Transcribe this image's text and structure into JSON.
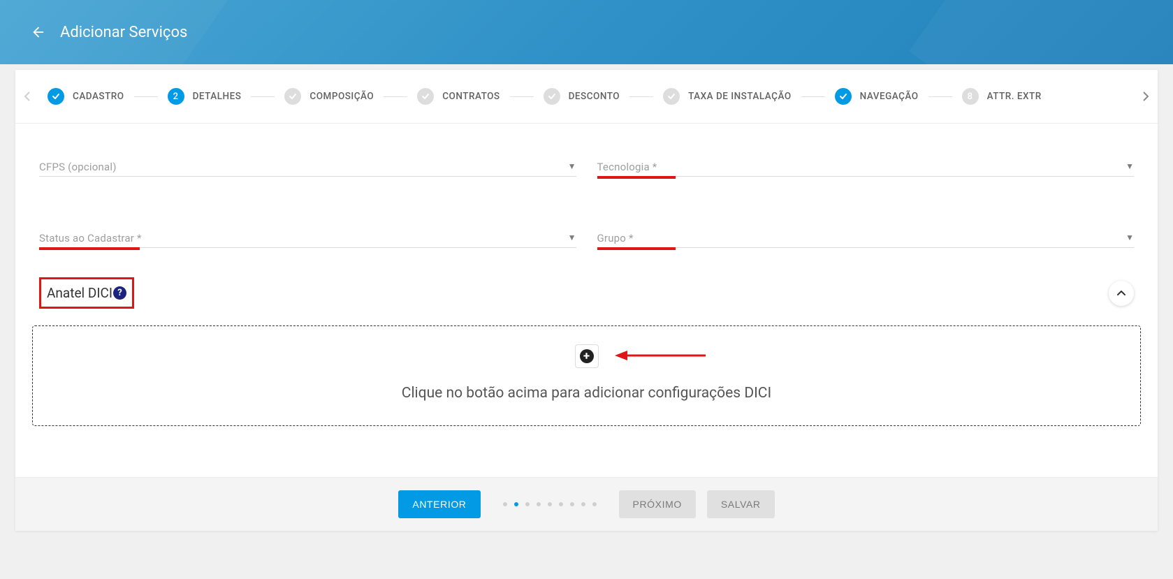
{
  "header": {
    "title": "Adicionar Serviços"
  },
  "stepper": {
    "steps": [
      {
        "label": "CADASTRO",
        "state": "done"
      },
      {
        "label": "DETALHES",
        "state": "current",
        "number": "2"
      },
      {
        "label": "COMPOSIÇÃO",
        "state": "pending"
      },
      {
        "label": "CONTRATOS",
        "state": "pending"
      },
      {
        "label": "DESCONTO",
        "state": "pending"
      },
      {
        "label": "TAXA DE INSTALAÇÃO",
        "state": "pending"
      },
      {
        "label": "NAVEGAÇÃO",
        "state": "done"
      },
      {
        "label": "ATTR. EXTR",
        "state": "pending",
        "number": "8"
      }
    ]
  },
  "form": {
    "cfps": {
      "label": "CFPS (opcional)"
    },
    "tech": {
      "label": "Tecnologia *"
    },
    "status": {
      "label": "Status ao Cadastrar *"
    },
    "group": {
      "label": "Grupo *"
    }
  },
  "section": {
    "title": "Anatel DICI",
    "add_hint": "Clique no botão acima para adicionar configurações DICI"
  },
  "footer": {
    "prev": "ANTERIOR",
    "next": "PRÓXIMO",
    "save": "SALVAR",
    "active_dot_index": 1,
    "dot_count": 9
  }
}
